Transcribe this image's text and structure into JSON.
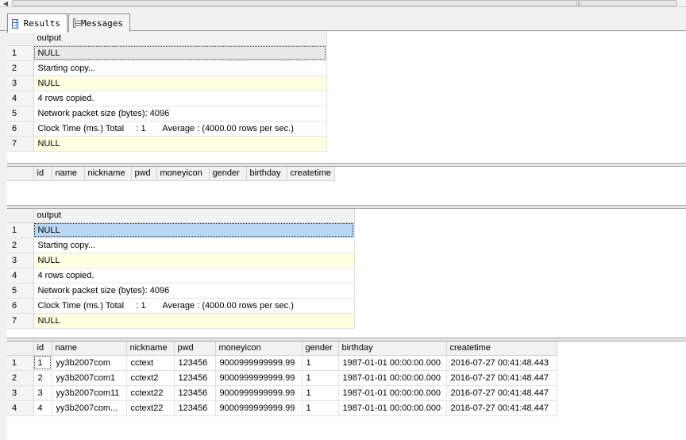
{
  "tabs": [
    {
      "label": "Results",
      "icon": "results-grid-icon",
      "active": true
    },
    {
      "label": "Messages",
      "icon": "messages-icon",
      "active": false
    }
  ],
  "grid1": {
    "columns": [
      "output"
    ],
    "rows": [
      {
        "n": "1",
        "output": "NULL"
      },
      {
        "n": "2",
        "output": "Starting copy..."
      },
      {
        "n": "3",
        "output": "NULL"
      },
      {
        "n": "4",
        "output": "4 rows copied."
      },
      {
        "n": "5",
        "output": "Network packet size (bytes): 4096"
      },
      {
        "n": "6",
        "output": "Clock Time (ms.) Total     : 1       Average : (4000.00 rows per sec.)"
      },
      {
        "n": "7",
        "output": "NULL"
      }
    ]
  },
  "grid2": {
    "columns": [
      "id",
      "name",
      "nickname",
      "pwd",
      "moneyicon",
      "gender",
      "birthday",
      "createtime"
    ]
  },
  "grid3": {
    "columns": [
      "output"
    ],
    "rows": [
      {
        "n": "1",
        "output": "NULL"
      },
      {
        "n": "2",
        "output": "Starting copy..."
      },
      {
        "n": "3",
        "output": "NULL"
      },
      {
        "n": "4",
        "output": "4 rows copied."
      },
      {
        "n": "5",
        "output": "Network packet size (bytes): 4096"
      },
      {
        "n": "6",
        "output": "Clock Time (ms.) Total     : 1       Average : (4000.00 rows per sec.)"
      },
      {
        "n": "7",
        "output": "NULL"
      }
    ]
  },
  "grid4": {
    "columns": [
      "id",
      "name",
      "nickname",
      "pwd",
      "moneyicon",
      "gender",
      "birthday",
      "createtime"
    ],
    "rows": [
      {
        "n": "1",
        "id": "1",
        "name": "yy3b2007com",
        "nickname": "cctext",
        "pwd": "123456",
        "moneyicon": "9000999999999.99",
        "gender": "1",
        "birthday": "1987-01-01 00:00:00.000",
        "createtime": "2016-07-27 00:41:48.443"
      },
      {
        "n": "2",
        "id": "2",
        "name": "yy3b2007com1",
        "nickname": "cctext2",
        "pwd": "123456",
        "moneyicon": "9000999999999.99",
        "gender": "1",
        "birthday": "1987-01-01 00:00:00.000",
        "createtime": "2016-07-27 00:41:48.447"
      },
      {
        "n": "3",
        "id": "3",
        "name": "yy3b2007com11",
        "nickname": "cctext22",
        "pwd": "123456",
        "moneyicon": "9000999999999.99",
        "gender": "1",
        "birthday": "1987-01-01 00:00:00.000",
        "createtime": "2016-07-27 00:41:48.447"
      },
      {
        "n": "4",
        "id": "4",
        "name": "yy3b2007com...",
        "nickname": "cctext22",
        "pwd": "123456",
        "moneyicon": "9000999999999.99",
        "gender": "1",
        "birthday": "1987-01-01 00:00:00.000",
        "createtime": "2016-07-27 00:41:48.447"
      }
    ]
  },
  "colors": {
    "null_row": "#ffffe1",
    "selected": "#b9d6f5",
    "header": "#f2f2f2"
  }
}
